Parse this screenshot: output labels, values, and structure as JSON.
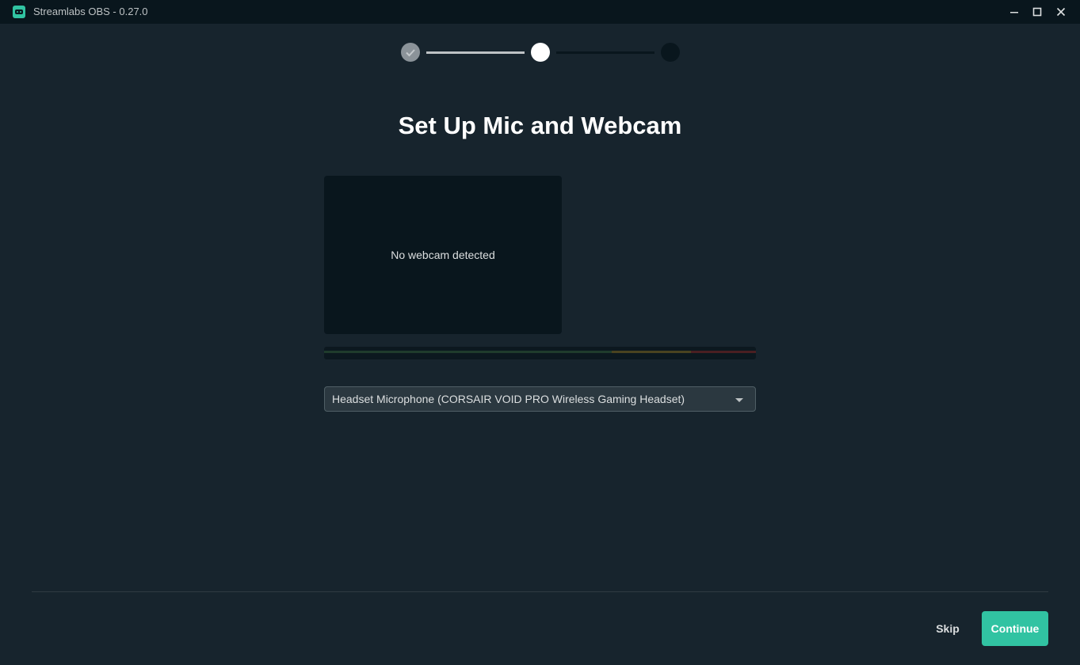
{
  "window": {
    "title": "Streamlabs OBS - 0.27.0",
    "app_icon": "streamlabs-logo-icon",
    "controls": [
      {
        "name": "minimize",
        "icon": "minimize-icon"
      },
      {
        "name": "maximize",
        "icon": "maximize-icon"
      },
      {
        "name": "close",
        "icon": "close-icon"
      }
    ]
  },
  "stepper": {
    "current_step": 2,
    "total_steps": 3,
    "steps": [
      {
        "state": "completed",
        "icon": "checkmark-icon"
      },
      {
        "state": "current"
      },
      {
        "state": "upcoming"
      }
    ]
  },
  "page": {
    "heading": "Set Up Mic and Webcam",
    "webcam_message": "No webcam detected",
    "mic_select": {
      "value": "Headset Microphone (CORSAIR VOID PRO Wireless Gaming Headset)",
      "icon": "chevron-down-icon"
    },
    "volume_meter": {
      "level": 0.0
    }
  },
  "footer": {
    "skip_label": "Skip",
    "continue_label": "Continue"
  },
  "colors": {
    "accent": "#31c3a2",
    "background": "#17242d",
    "titlebar": "#09161d",
    "meter_green": "#1f3b2c",
    "meter_yellow": "#4a4320",
    "meter_red": "#4a1f22"
  }
}
